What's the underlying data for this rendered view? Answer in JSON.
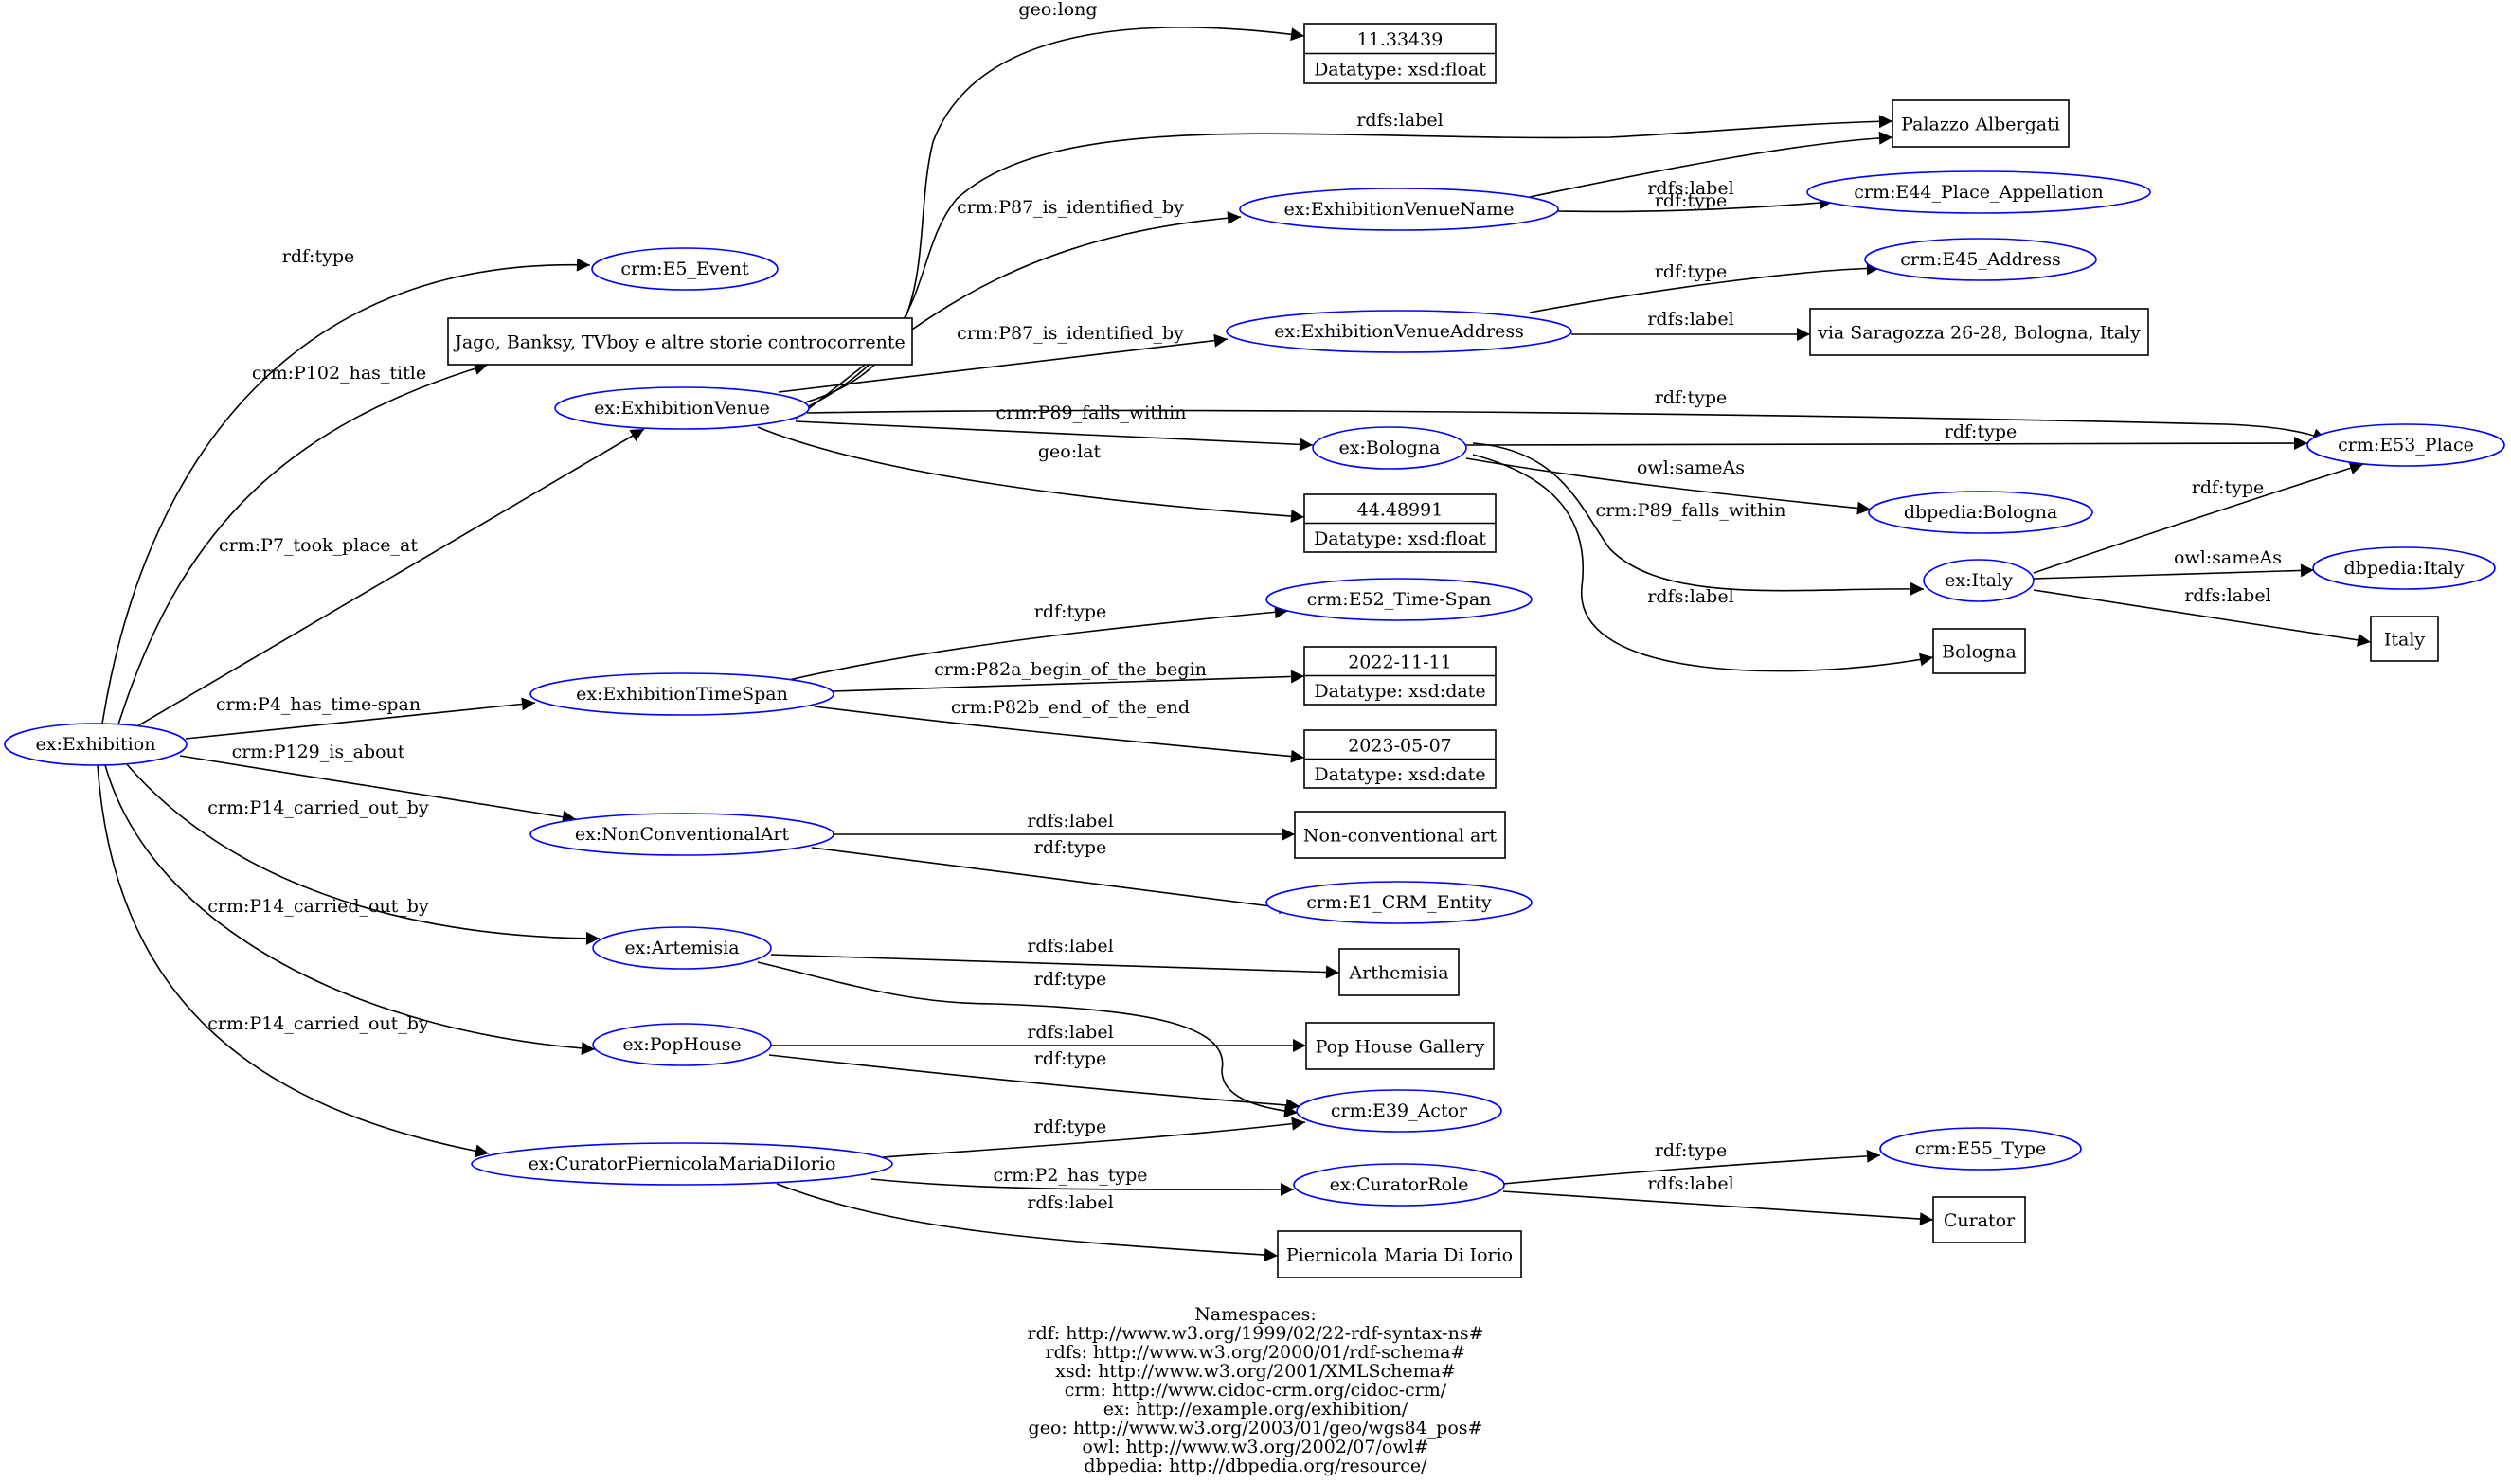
{
  "diagram": {
    "type": "rdf-graph",
    "colors": {
      "resource_stroke": "#0000ff",
      "literal_stroke": "#000000",
      "edge": "#000000"
    },
    "nodes": [
      {
        "id": "exhibition",
        "label": "ex:Exhibition",
        "kind": "resource"
      },
      {
        "id": "e5",
        "label": "crm:E5_Event",
        "kind": "resource"
      },
      {
        "id": "title",
        "label": "Jago, Banksy, TVboy e altre storie controcorrente",
        "kind": "literal"
      },
      {
        "id": "venue",
        "label": "ex:ExhibitionVenue",
        "kind": "resource"
      },
      {
        "id": "long",
        "label": "11.33439",
        "datatype": "Datatype: xsd:float",
        "kind": "typed-literal"
      },
      {
        "id": "palazzo",
        "label": "Palazzo Albergati",
        "kind": "literal"
      },
      {
        "id": "venuename",
        "label": "ex:ExhibitionVenueName",
        "kind": "resource"
      },
      {
        "id": "e44",
        "label": "crm:E44_Place_Appellation",
        "kind": "resource"
      },
      {
        "id": "e45",
        "label": "crm:E45_Address",
        "kind": "resource"
      },
      {
        "id": "venueaddr",
        "label": "ex:ExhibitionVenueAddress",
        "kind": "resource"
      },
      {
        "id": "addrlit",
        "label": "via Saragozza 26-28, Bologna, Italy",
        "kind": "literal"
      },
      {
        "id": "e53",
        "label": "crm:E53_Place",
        "kind": "resource"
      },
      {
        "id": "bologna",
        "label": "ex:Bologna",
        "kind": "resource"
      },
      {
        "id": "dbbologna",
        "label": "dbpedia:Bologna",
        "kind": "resource"
      },
      {
        "id": "lat",
        "label": "44.48991",
        "datatype": "Datatype: xsd:float",
        "kind": "typed-literal"
      },
      {
        "id": "italy",
        "label": "ex:Italy",
        "kind": "resource"
      },
      {
        "id": "dbitaly",
        "label": "dbpedia:Italy",
        "kind": "resource"
      },
      {
        "id": "italylit",
        "label": "Italy",
        "kind": "literal"
      },
      {
        "id": "bolognalit",
        "label": "Bologna",
        "kind": "literal"
      },
      {
        "id": "e52",
        "label": "crm:E52_Time-Span",
        "kind": "resource"
      },
      {
        "id": "timespan",
        "label": "ex:ExhibitionTimeSpan",
        "kind": "resource"
      },
      {
        "id": "begin",
        "label": "2022-11-11",
        "datatype": "Datatype: xsd:date",
        "kind": "typed-literal"
      },
      {
        "id": "end",
        "label": "2023-05-07",
        "datatype": "Datatype: xsd:date",
        "kind": "typed-literal"
      },
      {
        "id": "nca",
        "label": "ex:NonConventionalArt",
        "kind": "resource"
      },
      {
        "id": "ncalit",
        "label": "Non-conventional art",
        "kind": "literal"
      },
      {
        "id": "e1",
        "label": "crm:E1_CRM_Entity",
        "kind": "resource"
      },
      {
        "id": "artemisia",
        "label": "ex:Artemisia",
        "kind": "resource"
      },
      {
        "id": "arthemisialit",
        "label": "Arthemisia",
        "kind": "literal"
      },
      {
        "id": "pophouse",
        "label": "ex:PopHouse",
        "kind": "resource"
      },
      {
        "id": "pophouselit",
        "label": "Pop House Gallery",
        "kind": "literal"
      },
      {
        "id": "e39",
        "label": "crm:E39_Actor",
        "kind": "resource"
      },
      {
        "id": "curator",
        "label": "ex:CuratorPiernicolaMariaDiIorio",
        "kind": "resource"
      },
      {
        "id": "e55",
        "label": "crm:E55_Type",
        "kind": "resource"
      },
      {
        "id": "curatorrole",
        "label": "ex:CuratorRole",
        "kind": "resource"
      },
      {
        "id": "curatorlit",
        "label": "Curator",
        "kind": "literal"
      },
      {
        "id": "curatornamelit",
        "label": "Piernicola Maria Di Iorio",
        "kind": "literal"
      }
    ],
    "edges": [
      {
        "from": "exhibition",
        "to": "e5",
        "label": "rdf:type"
      },
      {
        "from": "exhibition",
        "to": "title",
        "label": "crm:P102_has_title"
      },
      {
        "from": "exhibition",
        "to": "venue",
        "label": "crm:P7_took_place_at"
      },
      {
        "from": "exhibition",
        "to": "timespan",
        "label": "crm:P4_has_time-span"
      },
      {
        "from": "exhibition",
        "to": "nca",
        "label": "crm:P129_is_about"
      },
      {
        "from": "exhibition",
        "to": "artemisia",
        "label": "crm:P14_carried_out_by"
      },
      {
        "from": "exhibition",
        "to": "pophouse",
        "label": "crm:P14_carried_out_by"
      },
      {
        "from": "exhibition",
        "to": "curator",
        "label": "crm:P14_carried_out_by"
      },
      {
        "from": "venue",
        "to": "long",
        "label": "geo:long"
      },
      {
        "from": "venue",
        "to": "palazzo",
        "label": "rdfs:label"
      },
      {
        "from": "venue",
        "to": "venuename",
        "label": "crm:P87_is_identified_by"
      },
      {
        "from": "venue",
        "to": "venueaddr",
        "label": "crm:P87_is_identified_by"
      },
      {
        "from": "venue",
        "to": "e53",
        "label": "rdf:type"
      },
      {
        "from": "venue",
        "to": "bologna",
        "label": "crm:P89_falls_within"
      },
      {
        "from": "venue",
        "to": "lat",
        "label": "geo:lat"
      },
      {
        "from": "venuename",
        "to": "palazzo",
        "label": "rdfs:label"
      },
      {
        "from": "venuename",
        "to": "e44",
        "label": "rdf:type"
      },
      {
        "from": "venueaddr",
        "to": "e45",
        "label": "rdf:type"
      },
      {
        "from": "venueaddr",
        "to": "addrlit",
        "label": "rdfs:label"
      },
      {
        "from": "bologna",
        "to": "e53",
        "label": "rdf:type"
      },
      {
        "from": "bologna",
        "to": "dbbologna",
        "label": "owl:sameAs"
      },
      {
        "from": "bologna",
        "to": "italy",
        "label": "crm:P89_falls_within"
      },
      {
        "from": "bologna",
        "to": "bolognalit",
        "label": "rdfs:label"
      },
      {
        "from": "italy",
        "to": "e53",
        "label": "rdf:type"
      },
      {
        "from": "italy",
        "to": "dbitaly",
        "label": "owl:sameAs"
      },
      {
        "from": "italy",
        "to": "italylit",
        "label": "rdfs:label"
      },
      {
        "from": "timespan",
        "to": "e52",
        "label": "rdf:type"
      },
      {
        "from": "timespan",
        "to": "begin",
        "label": "crm:P82a_begin_of_the_begin"
      },
      {
        "from": "timespan",
        "to": "end",
        "label": "crm:P82b_end_of_the_end"
      },
      {
        "from": "nca",
        "to": "ncalit",
        "label": "rdfs:label"
      },
      {
        "from": "nca",
        "to": "e1",
        "label": "rdf:type"
      },
      {
        "from": "artemisia",
        "to": "arthemisialit",
        "label": "rdfs:label"
      },
      {
        "from": "artemisia",
        "to": "e39",
        "label": "rdf:type"
      },
      {
        "from": "pophouse",
        "to": "pophouselit",
        "label": "rdfs:label"
      },
      {
        "from": "pophouse",
        "to": "e39",
        "label": "rdf:type"
      },
      {
        "from": "curator",
        "to": "e39",
        "label": "rdf:type"
      },
      {
        "from": "curator",
        "to": "curatorrole",
        "label": "crm:P2_has_type"
      },
      {
        "from": "curator",
        "to": "curatornamelit",
        "label": "rdfs:label"
      },
      {
        "from": "curatorrole",
        "to": "e55",
        "label": "rdf:type"
      },
      {
        "from": "curatorrole",
        "to": "curatorlit",
        "label": "rdfs:label"
      }
    ]
  },
  "namespaces": {
    "title": "Namespaces:",
    "lines": [
      "rdf: http://www.w3.org/1999/02/22-rdf-syntax-ns#",
      "rdfs: http://www.w3.org/2000/01/rdf-schema#",
      "xsd: http://www.w3.org/2001/XMLSchema#",
      "crm: http://www.cidoc-crm.org/cidoc-crm/",
      "ex: http://example.org/exhibition/",
      "geo: http://www.w3.org/2003/01/geo/wgs84_pos#",
      "owl: http://www.w3.org/2002/07/owl#",
      "dbpedia: http://dbpedia.org/resource/"
    ]
  }
}
